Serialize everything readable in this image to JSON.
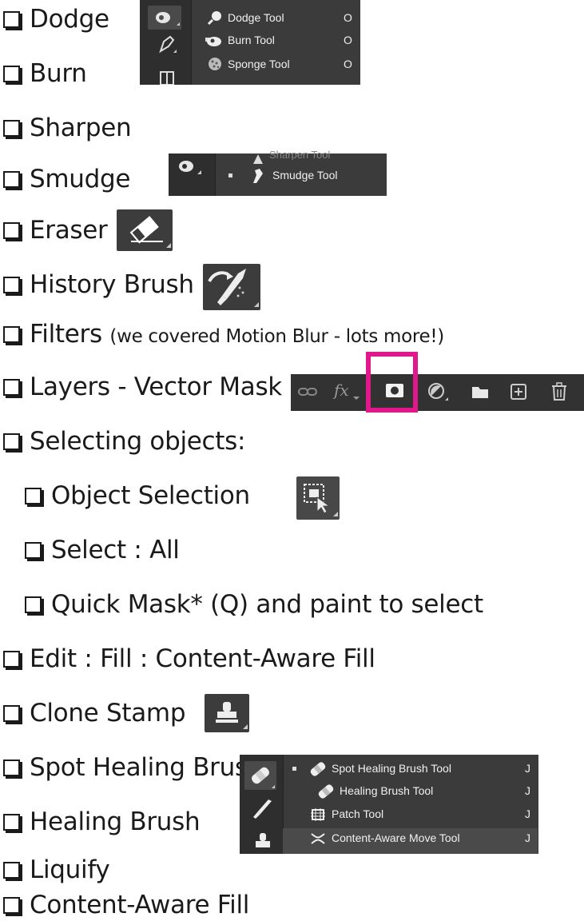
{
  "items": [
    "Dodge",
    "Burn",
    "Sharpen",
    "Smudge",
    "Eraser",
    "History Brush"
  ],
  "filters": {
    "label": "Filters",
    "note": "(we covered Motion Blur - lots more!)"
  },
  "layers_label": "Layers - Vector Mask",
  "selecting_label": "Selecting objects:",
  "sub_items": [
    "Object Selection",
    "Select : All",
    "Quick Mask* (Q) and paint to select"
  ],
  "items2": [
    "Edit : Fill : Content-Aware Fill",
    "Clone Stamp",
    "Spot Healing Brush",
    "Healing Brush",
    "Liquify",
    "Content-Aware Fill"
  ],
  "dodge_menu": [
    {
      "label": "Dodge Tool",
      "key": "O"
    },
    {
      "label": "Burn Tool",
      "key": "O"
    },
    {
      "label": "Sponge Tool",
      "key": "O"
    }
  ],
  "smudge_menu": [
    {
      "label": "Sharpen Tool"
    },
    {
      "label": "Smudge Tool"
    }
  ],
  "healing_menu": [
    {
      "label": "Spot Healing Brush Tool",
      "key": "J"
    },
    {
      "label": "Healing Brush Tool",
      "key": "J"
    },
    {
      "label": "Patch Tool",
      "key": "J"
    },
    {
      "label": "Content-Aware Move Tool",
      "key": "J"
    }
  ],
  "layers_icons": [
    "link-icon",
    "fx-icon",
    "mask-icon",
    "adjustment-icon",
    "folder-icon",
    "new-layer-icon",
    "trash-icon"
  ],
  "colors": {
    "highlight": "#e0188c",
    "panel": "#3c3c3c"
  }
}
